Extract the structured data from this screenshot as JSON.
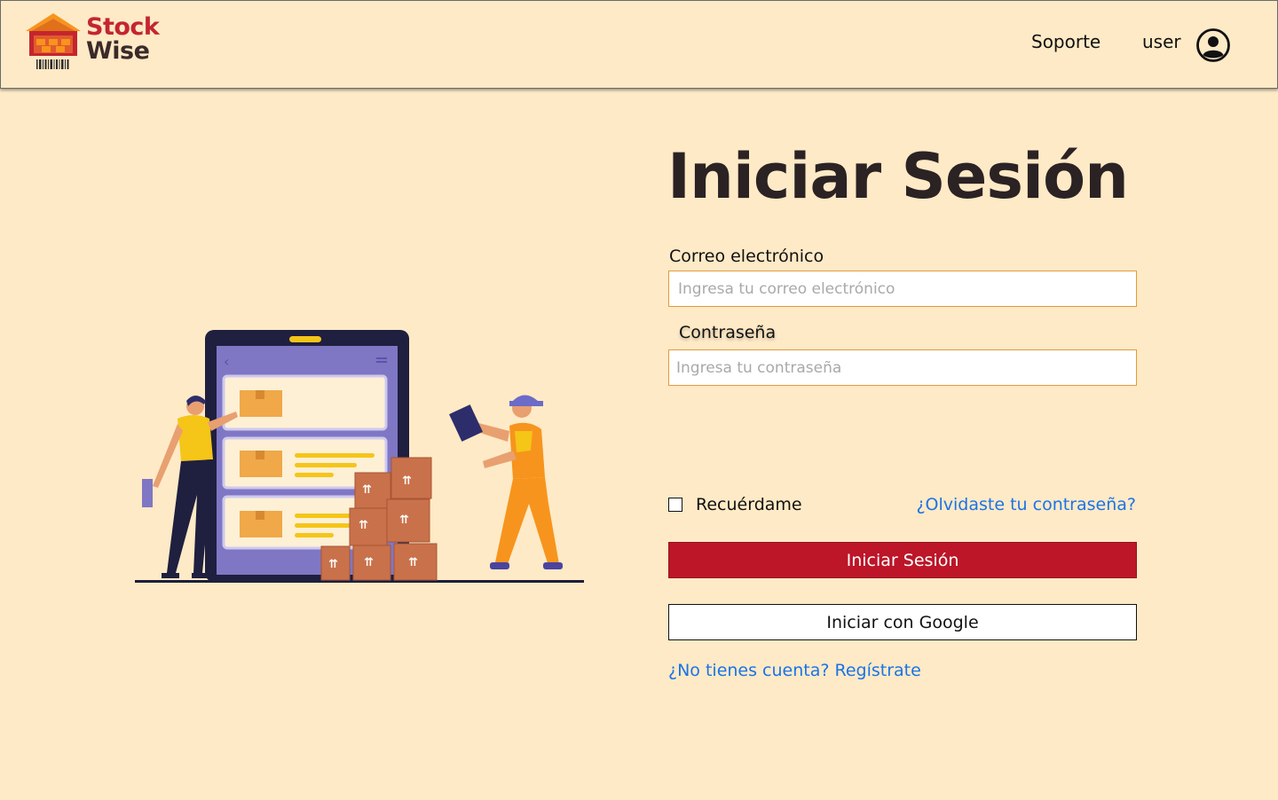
{
  "brand": {
    "line1": "Stock",
    "line2": "Wise",
    "colors": {
      "primary": "#C4252E",
      "secondary": "#3B2A2A",
      "accent": "#F7941D"
    }
  },
  "nav": {
    "support_label": "Soporte",
    "user_label": "user",
    "user_icon": "user-circle-icon"
  },
  "login": {
    "title": "Iniciar Sesión",
    "email_label": "Correo electrónico",
    "email_placeholder": "Ingresa tu correo electrónico",
    "email_value": "",
    "password_label": "Contraseña",
    "password_placeholder": "Ingresa tu contraseña",
    "password_value": "",
    "remember_label": "Recuérdame",
    "remember_checked": false,
    "forgot_label": "¿Olvidaste tu contraseña?",
    "submit_label": "Iniciar Sesión",
    "google_label": "Iniciar con Google",
    "register_label": "¿No tienes cuenta? Regístrate"
  },
  "theme": {
    "background": "#FEEAC6",
    "button_primary": "#BC1628",
    "link": "#1A73E8",
    "input_border": "#E39A3B"
  }
}
